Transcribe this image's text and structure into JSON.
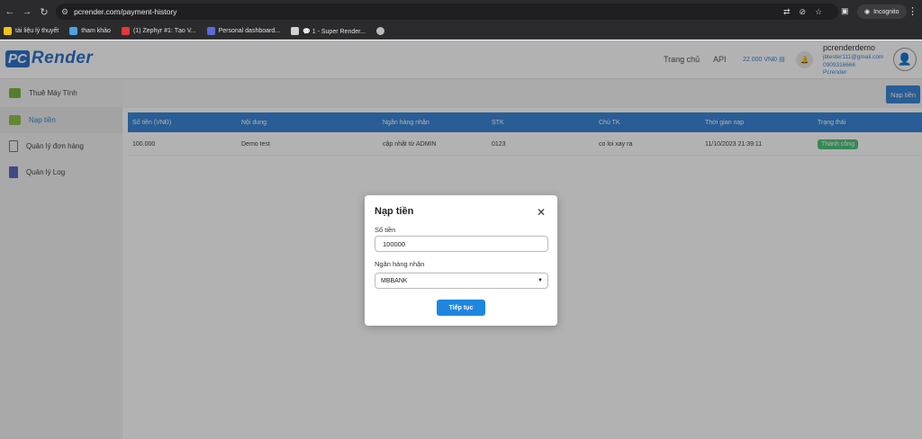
{
  "browser": {
    "url": "pcrender.com/payment-history",
    "incognito_label": "Incognito",
    "bookmarks": [
      {
        "label": "tài liệu lý thuyết",
        "color": "#f0c419"
      },
      {
        "label": "tham khảo",
        "color": "#4aa3df"
      },
      {
        "label": "(1) Zephyr #1: Tạo V...",
        "color": "#e53935"
      },
      {
        "label": "Personal dashboard...",
        "color": "#5b6bd6"
      },
      {
        "label": "💬 1 - Super Render...",
        "color": "#cfcfcf"
      },
      {
        "label": "",
        "color": "#bbbbbb"
      }
    ]
  },
  "header": {
    "logo_pc": "PC",
    "logo_render": "Render",
    "nav": [
      "Trang chủ",
      "API"
    ],
    "balance": "22.000 VNĐ",
    "user": {
      "name": "pcrenderdemo",
      "email": "jbtester111@gmail.com",
      "phone": "0909316666",
      "org": "Pcrender"
    }
  },
  "sidebar": {
    "items": [
      {
        "label": "Thuê Máy Tính",
        "active": false,
        "icon": "gpu-icon"
      },
      {
        "label": "Nạp tiền",
        "active": true,
        "icon": "card-icon"
      },
      {
        "label": "Quản lý đơn hàng",
        "active": false,
        "icon": "clipboard-icon"
      },
      {
        "label": "Quản lý Log",
        "active": false,
        "icon": "document-icon"
      }
    ]
  },
  "main": {
    "topup_button": "Nạp tiền",
    "table": {
      "headers": [
        "Số tiền (VNĐ)",
        "Nội dung",
        "Ngân hàng nhận",
        "STK",
        "Chủ TK",
        "Thời gian nạp",
        "Trạng thái"
      ],
      "rows": [
        [
          "100.000",
          "Demo test",
          "cập nhật từ ADMIN",
          "0123",
          "co loi xay ra",
          "11/10/2023 21:39:11",
          "Thành công"
        ]
      ]
    },
    "pagination": {
      "prev": "‹",
      "current": "1",
      "next": "›"
    }
  },
  "modal": {
    "title": "Nạp tiền",
    "amount_label": "Số tiền",
    "amount_value": "100000",
    "bank_label": "Ngân hàng nhận",
    "bank_value": "MBBANK",
    "continue_label": "Tiếp tục"
  },
  "colors": {
    "accent": "#3b86d6",
    "success": "#4cc47a"
  }
}
